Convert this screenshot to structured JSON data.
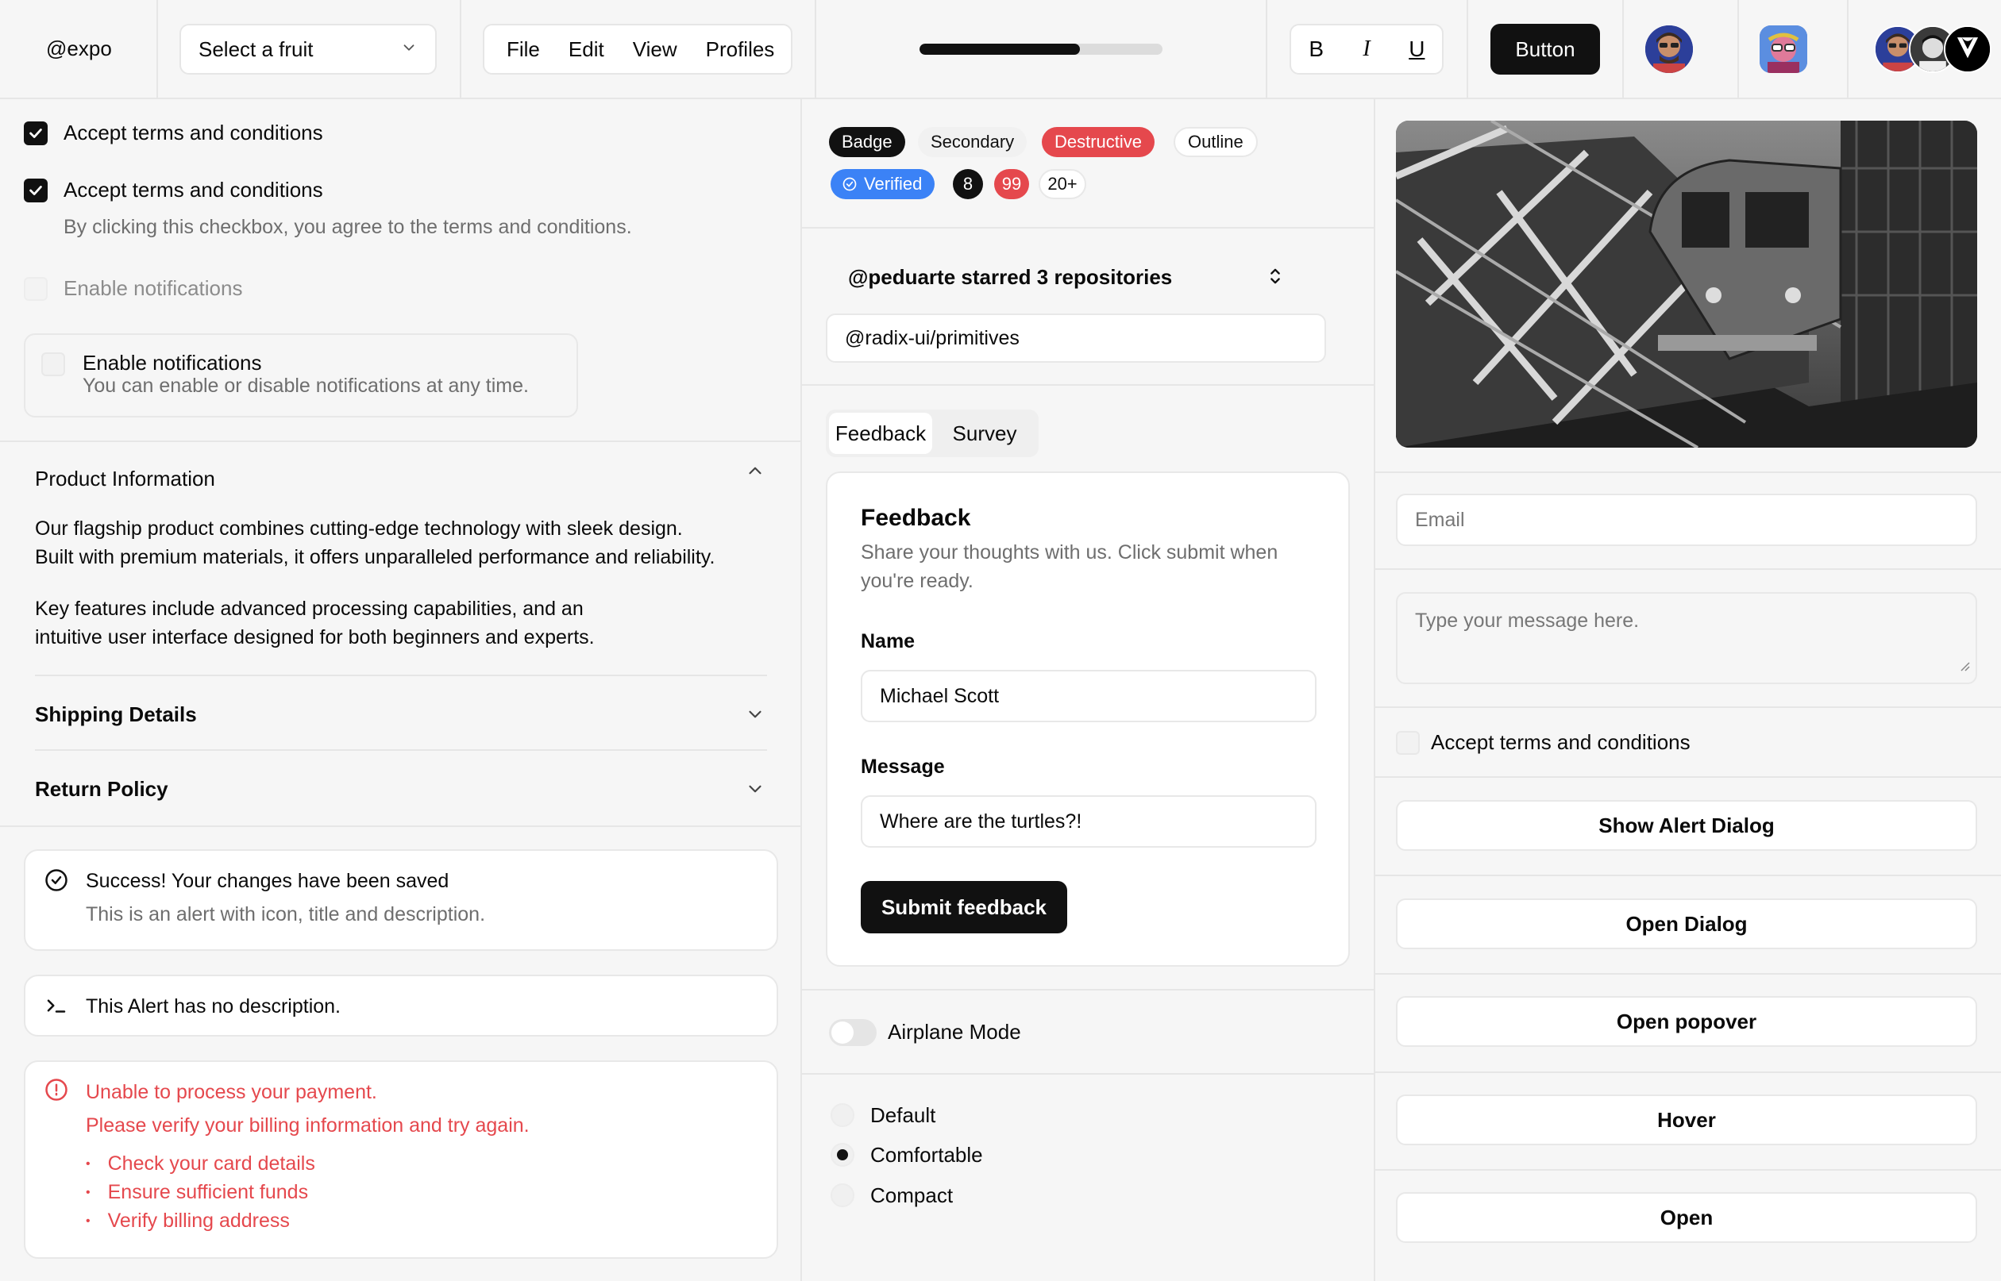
{
  "topbar": {
    "handle": "@expo",
    "select_value": "Select a fruit",
    "menus": [
      "File",
      "Edit",
      "View",
      "Profiles"
    ],
    "progress_fraction": 0.66,
    "format_toggles": [
      "B",
      "I",
      "U"
    ],
    "button_label": "Button"
  },
  "left": {
    "checkbox1_label": "Accept terms and conditions",
    "checkbox2_label": "Accept terms and conditions",
    "checkbox2_desc": "By clicking this checkbox, you agree to the terms and conditions.",
    "checkbox3_label": "Enable notifications",
    "notif_card_title": "Enable notifications",
    "notif_card_desc": "You can enable or disable notifications at any time.",
    "accordion": {
      "item1_title": "Product Information",
      "item1_p1_l1": "Our flagship product combines cutting-edge technology with sleek design.",
      "item1_p1_l2": "Built with premium materials, it offers unparalleled performance and reliability.",
      "item1_p2_l1": "Key features include advanced processing capabilities, and an",
      "item1_p2_l2": "intuitive user interface designed for both beginners and experts.",
      "item2_title": "Shipping Details",
      "item3_title": "Return Policy"
    },
    "alert1_title": "Success! Your changes have been saved",
    "alert1_desc": "This is an alert with icon, title and description.",
    "alert2_title": "This Alert has no description.",
    "alert3_title": "Unable to process your payment.",
    "alert3_desc": "Please verify your billing information and try again.",
    "alert3_items": [
      "Check your card details",
      "Ensure sufficient funds",
      "Verify billing address"
    ]
  },
  "middle": {
    "badges": [
      "Badge",
      "Secondary",
      "Destructive",
      "Outline"
    ],
    "verified": "Verified",
    "count_badges": [
      "8",
      "99",
      "20+"
    ],
    "collapsible_title": "@peduarte starred 3 repositories",
    "collapsible_item": "@radix-ui/primitives",
    "tabs": [
      "Feedback",
      "Survey"
    ],
    "feedback": {
      "title": "Feedback",
      "desc_l1": "Share your thoughts with us. Click submit when",
      "desc_l2": "you're ready.",
      "name_label": "Name",
      "name_value": "Michael Scott",
      "message_label": "Message",
      "message_value": "Where are the turtles?!",
      "submit": "Submit feedback"
    },
    "switch_label": "Airplane Mode",
    "radios": [
      "Default",
      "Comfortable",
      "Compact"
    ],
    "radio_selected": "Comfortable"
  },
  "right": {
    "email_placeholder": "Email",
    "message_placeholder": "Type your message here.",
    "checkbox_label": "Accept terms and conditions",
    "buttons": [
      "Show Alert Dialog",
      "Open Dialog",
      "Open popover",
      "Hover",
      "Open"
    ]
  }
}
